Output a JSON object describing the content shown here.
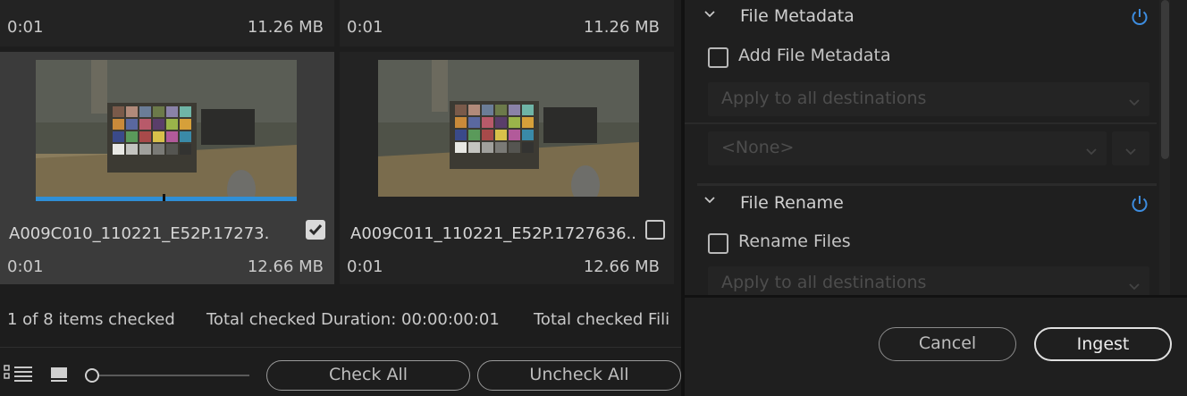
{
  "clips": [
    {
      "duration": "0:01",
      "size": "11.26 MB"
    },
    {
      "duration": "0:01",
      "size": "11.26 MB"
    }
  ],
  "cards": [
    {
      "name": "A009C010_110221_E52P.17273...",
      "duration": "0:01",
      "size": "12.66 MB",
      "checked": true,
      "selected": true
    },
    {
      "name": "A009C011_110221_E52P.1727636...",
      "duration": "0:01",
      "size": "12.66 MB",
      "checked": false,
      "selected": false
    }
  ],
  "status": {
    "checked_count": "1 of 8 items checked",
    "duration": "Total checked Duration: 00:00:00:01",
    "files": "Total checked Fili"
  },
  "footer": {
    "check_all": "Check All",
    "uncheck_all": "Uncheck All"
  },
  "file_metadata": {
    "title": "File Metadata",
    "checkbox_label": "Add File Metadata",
    "apply_dropdown": "Apply to all destinations",
    "preset_dropdown": "<None>"
  },
  "file_rename": {
    "title": "File Rename",
    "checkbox_label": "Rename Files",
    "apply_dropdown": "Apply to all destinations"
  },
  "actions": {
    "cancel": "Cancel",
    "ingest": "Ingest"
  },
  "colors": {
    "accent_power": "#3d8de0",
    "timeline_blue": "#2f8fd6"
  }
}
